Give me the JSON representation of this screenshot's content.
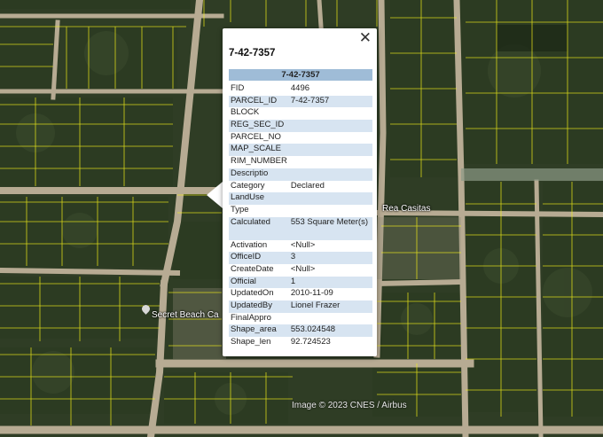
{
  "map": {
    "place_labels": [
      "Rea Casitas",
      "Secret Beach Ca"
    ],
    "credit": "Image © 2023 CNES / Airbus"
  },
  "popup": {
    "title": "7-42-7357",
    "table_header": "7-42-7357",
    "close_icon": "close-icon",
    "rows": [
      {
        "key": "FID",
        "value": "4496"
      },
      {
        "key": "PARCEL_ID",
        "value": "7-42-7357"
      },
      {
        "key": "BLOCK",
        "value": ""
      },
      {
        "key": "REG_SEC_ID",
        "value": ""
      },
      {
        "key": "PARCEL_NO",
        "value": ""
      },
      {
        "key": "MAP_SCALE",
        "value": ""
      },
      {
        "key": "RIM_NUMBER",
        "value": ""
      },
      {
        "key": "Descriptio",
        "value": ""
      },
      {
        "key": "Category",
        "value": "Declared"
      },
      {
        "key": "LandUse",
        "value": ""
      },
      {
        "key": "Type",
        "value": ""
      },
      {
        "key": "Calculated",
        "value": "553 Square Meter(s)"
      },
      {
        "key": "Activation",
        "value": "<Null>"
      },
      {
        "key": "OfficeID",
        "value": "3"
      },
      {
        "key": "CreateDate",
        "value": "<Null>"
      },
      {
        "key": "Official",
        "value": "1"
      },
      {
        "key": "UpdatedOn",
        "value": "2010-11-09"
      },
      {
        "key": "UpdatedBy",
        "value": "Lionel Frazer"
      },
      {
        "key": "FinalAppro",
        "value": ""
      },
      {
        "key": "Shape_area",
        "value": "553.024548"
      },
      {
        "key": "Shape_len",
        "value": "92.724523"
      }
    ]
  }
}
